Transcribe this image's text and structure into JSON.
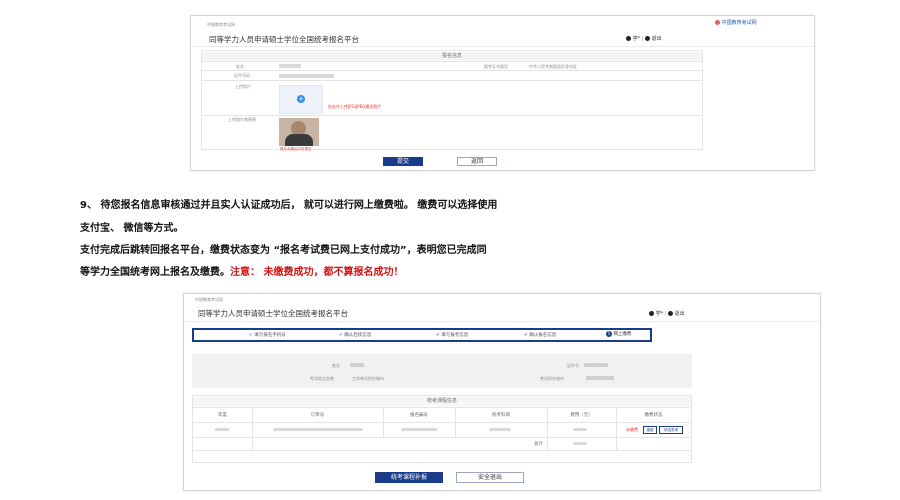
{
  "top_screen": {
    "breadcrumb": "中国教育考试网",
    "title": "同等学力人员申请硕士学位全国统考报名平台",
    "user_label": "学*",
    "logout_label": "退出",
    "brand_text": "中国教育考试网",
    "section_header": "报名信息",
    "fields": {
      "name_label": "姓名",
      "id_label": "证件号码",
      "upload_label": "上传照片",
      "exam_type_label": "报考证书类型",
      "exam_type_value": "中华人民共和国居民身份证",
      "upload_hint": "仅允许上传JPG/JPEG格式图片",
      "photo_label": "上传照片效果图",
      "photo_hint": "照片合格后方可提交"
    },
    "buttons": {
      "submit": "提交",
      "back": "返回"
    }
  },
  "instructions": {
    "line1": "9、 待您报名信息审核通过并且实人认证成功后， 就可以进行网上缴费啦。 缴费可以选择使用",
    "line2": "支付宝、 微信等方式。",
    "line3": "支付完成后跳转回报名平台，缴费状态变为 “报名考试费已网上支付成功”，表明您已完成同",
    "line4_normal": "等学力全国统考网上报名及缴费。",
    "line4_warning": "注意： 未缴费成功，都不算报名成功！"
  },
  "bottom_screen": {
    "breadcrumb": "中国教育考试网",
    "title": "同等学力人员申请硕士学位全国统考报名平台",
    "user_label": "学*",
    "logout_label": "退出",
    "steps": [
      {
        "label": "填写报名手机号",
        "state": "done"
      },
      {
        "label": "确认后续信息",
        "state": "done"
      },
      {
        "label": "填写报考信息",
        "state": "done"
      },
      {
        "label": "确认报名信息",
        "state": "done"
      },
      {
        "label": "网上缴费",
        "state": "current",
        "number": "5"
      }
    ],
    "info": {
      "name_label": "姓名",
      "exam_place_label": "考试地点名称",
      "exam_place_value": "工作单位所在城市",
      "id_label": "证件号",
      "exam_site_label": "考试所在城市"
    },
    "course_table": {
      "caption": "统考课程信息",
      "headers": [
        "年度",
        "订单号",
        "报名编号",
        "统考科目",
        "费用（元）",
        "缴费状态"
      ],
      "status_unpaid": "未缴费",
      "pay_button": "缴费",
      "refresh_button": "状态查询",
      "total_label": "总计"
    },
    "buttons": {
      "supplement": "统考课程补报",
      "logout": "安全退出"
    }
  },
  "colors": {
    "brand_blue": "#1a3c8c",
    "warning_red": "#d21414",
    "step_border": "#1a3c8c"
  }
}
